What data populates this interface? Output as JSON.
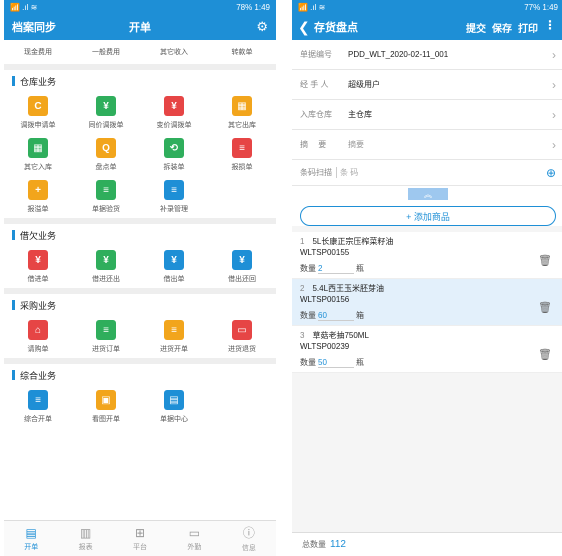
{
  "left": {
    "status": {
      "left": "📶 .ıl ≋",
      "right": "78% 1:49"
    },
    "header": {
      "sync_label": "档案同步",
      "title": "开单",
      "settings_icon": "gear-icon"
    },
    "top_row": [
      "现金费用",
      "一般费用",
      "其它收入",
      "转款单"
    ],
    "sections": [
      {
        "title": "仓库业务",
        "items": [
          {
            "label": "调拨申请单",
            "color": "#f2a51c",
            "glyph": "C"
          },
          {
            "label": "同价调拨单",
            "color": "#2fae5c",
            "glyph": "¥"
          },
          {
            "label": "变价调拨单",
            "color": "#e64545",
            "glyph": "¥"
          },
          {
            "label": "其它出库",
            "color": "#f2a51c",
            "glyph": "▦"
          },
          {
            "label": "其它入库",
            "color": "#2fae5c",
            "glyph": "▦"
          },
          {
            "label": "盘点单",
            "color": "#f2a51c",
            "glyph": "Q"
          },
          {
            "label": "拆装单",
            "color": "#2fae5c",
            "glyph": "⟲"
          },
          {
            "label": "报损单",
            "color": "#e64545",
            "glyph": "≡"
          },
          {
            "label": "报溢单",
            "color": "#f2a51c",
            "glyph": "+"
          },
          {
            "label": "单据验货",
            "color": "#2fae5c",
            "glyph": "≡"
          },
          {
            "label": "补录管理",
            "color": "#1e8fd6",
            "glyph": "≡"
          }
        ]
      },
      {
        "title": "借欠业务",
        "items": [
          {
            "label": "借进单",
            "color": "#e64545",
            "glyph": "¥"
          },
          {
            "label": "借进还出",
            "color": "#2fae5c",
            "glyph": "¥"
          },
          {
            "label": "借出单",
            "color": "#1e8fd6",
            "glyph": "¥"
          },
          {
            "label": "借出还回",
            "color": "#1e8fd6",
            "glyph": "¥"
          }
        ]
      },
      {
        "title": "采购业务",
        "items": [
          {
            "label": "请购单",
            "color": "#e64545",
            "glyph": "⌂"
          },
          {
            "label": "进货订单",
            "color": "#2fae5c",
            "glyph": "≡"
          },
          {
            "label": "进货开单",
            "color": "#f2a51c",
            "glyph": "≡"
          },
          {
            "label": "进货退货",
            "color": "#e64545",
            "glyph": "▭"
          }
        ]
      },
      {
        "title": "综合业务",
        "items": [
          {
            "label": "综合开单",
            "color": "#1e8fd6",
            "glyph": "≡"
          },
          {
            "label": "看图开单",
            "color": "#f2a51c",
            "glyph": "▣"
          },
          {
            "label": "单据中心",
            "color": "#1e8fd6",
            "glyph": "▤"
          }
        ]
      }
    ],
    "nav": [
      {
        "label": "开单",
        "icon": "▤",
        "name": "nav-order",
        "active": true
      },
      {
        "label": "报表",
        "icon": "▥",
        "name": "nav-report",
        "active": false
      },
      {
        "label": "平台",
        "icon": "⊞",
        "name": "nav-platform",
        "active": false
      },
      {
        "label": "外勤",
        "icon": "▭",
        "name": "nav-field",
        "active": false
      },
      {
        "label": "信息",
        "icon": "ⓘ",
        "name": "nav-info",
        "active": false
      }
    ]
  },
  "right": {
    "status": {
      "left": "📶 .ıl ≋",
      "right": "77% 1:49"
    },
    "header": {
      "back": "❮",
      "title": "存货盘点",
      "submit": "提交",
      "save": "保存",
      "print": "打印",
      "more": "⋮"
    },
    "form": [
      {
        "key": "单据编号",
        "value": "PDD_WLT_2020-02-11_001",
        "placeholder": false
      },
      {
        "key": "经 手 人",
        "value": "超级用户",
        "placeholder": false
      },
      {
        "key": "入库仓库",
        "value": "主仓库",
        "placeholder": false
      },
      {
        "key": "摘　 要",
        "value": "摘要",
        "placeholder": true
      }
    ],
    "scan": {
      "label": "条码扫描",
      "placeholder": "条 码"
    },
    "collapse": "︽",
    "add_button": "+ 添加商品",
    "items": [
      {
        "index": "1",
        "name": "5L长康正宗压榨菜籽油",
        "code": "WLTSP00155",
        "qty_label": "数量",
        "qty": "2",
        "unit": "瓶",
        "selected": false
      },
      {
        "index": "2",
        "name": "5.4L西王玉米胚芽油",
        "code": "WLTSP00156",
        "qty_label": "数量",
        "qty": "60",
        "unit": "箱",
        "selected": true
      },
      {
        "index": "3",
        "name": "草菇老抽750ML",
        "code": "WLTSP00239",
        "qty_label": "数量",
        "qty": "50",
        "unit": "瓶",
        "selected": false
      }
    ],
    "footer": {
      "label": "总数量",
      "total": "112"
    }
  }
}
